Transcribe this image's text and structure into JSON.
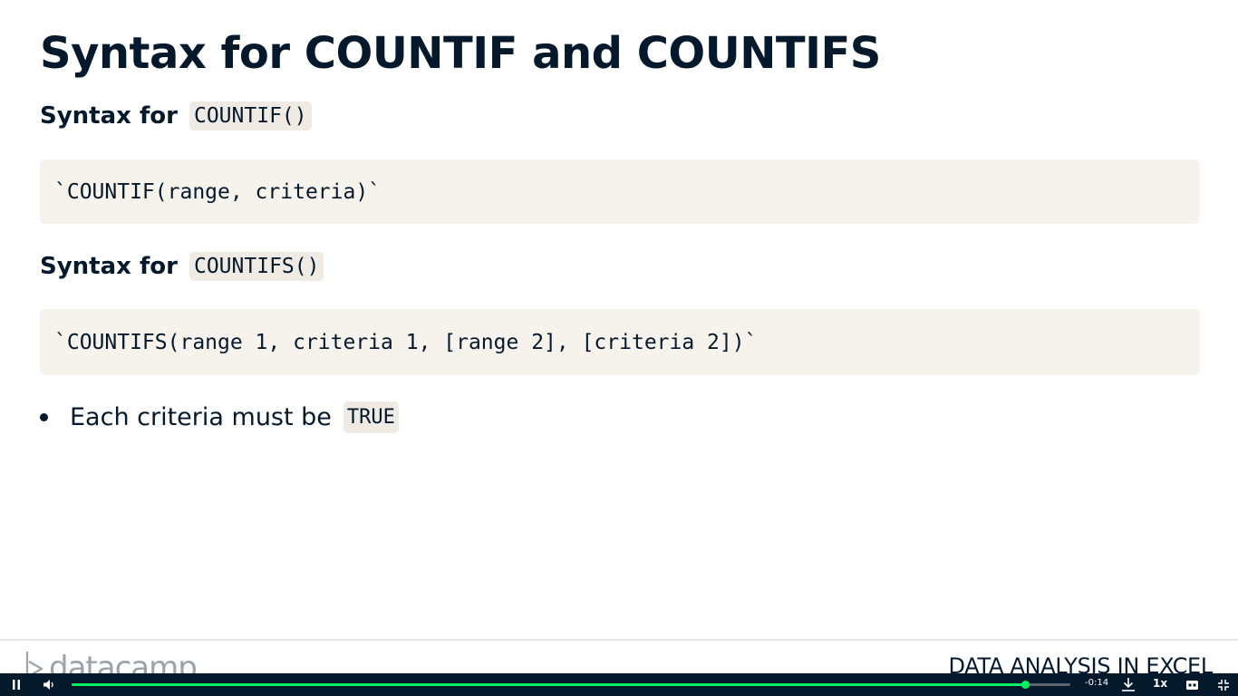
{
  "slide": {
    "title": "Syntax for COUNTIF and COUNTIFS",
    "section1": {
      "label": "Syntax for",
      "code": "COUNTIF()",
      "block": "`COUNTIF(range, criteria)`"
    },
    "section2": {
      "label": "Syntax for",
      "code": "COUNTIFS()",
      "block": "`COUNTIFS(range 1, criteria 1, [range 2], [criteria 2])`"
    },
    "bullet": {
      "text": "Each criteria must be",
      "code": "TRUE"
    }
  },
  "footer": {
    "logo_text": "datacamp",
    "course_title": "DATA ANALYSIS IN EXCEL"
  },
  "player": {
    "time_remaining": "-0:14",
    "speed": "1x",
    "progress_fraction": 0.955,
    "icons": [
      "pause-icon",
      "volume-icon",
      "download-icon",
      "captions-icon",
      "exit-fullscreen-icon"
    ]
  },
  "colors": {
    "text": "#05192d",
    "code_bg": "#f6f2ec",
    "player_bg": "#05192d",
    "progress": "#03ef62"
  }
}
